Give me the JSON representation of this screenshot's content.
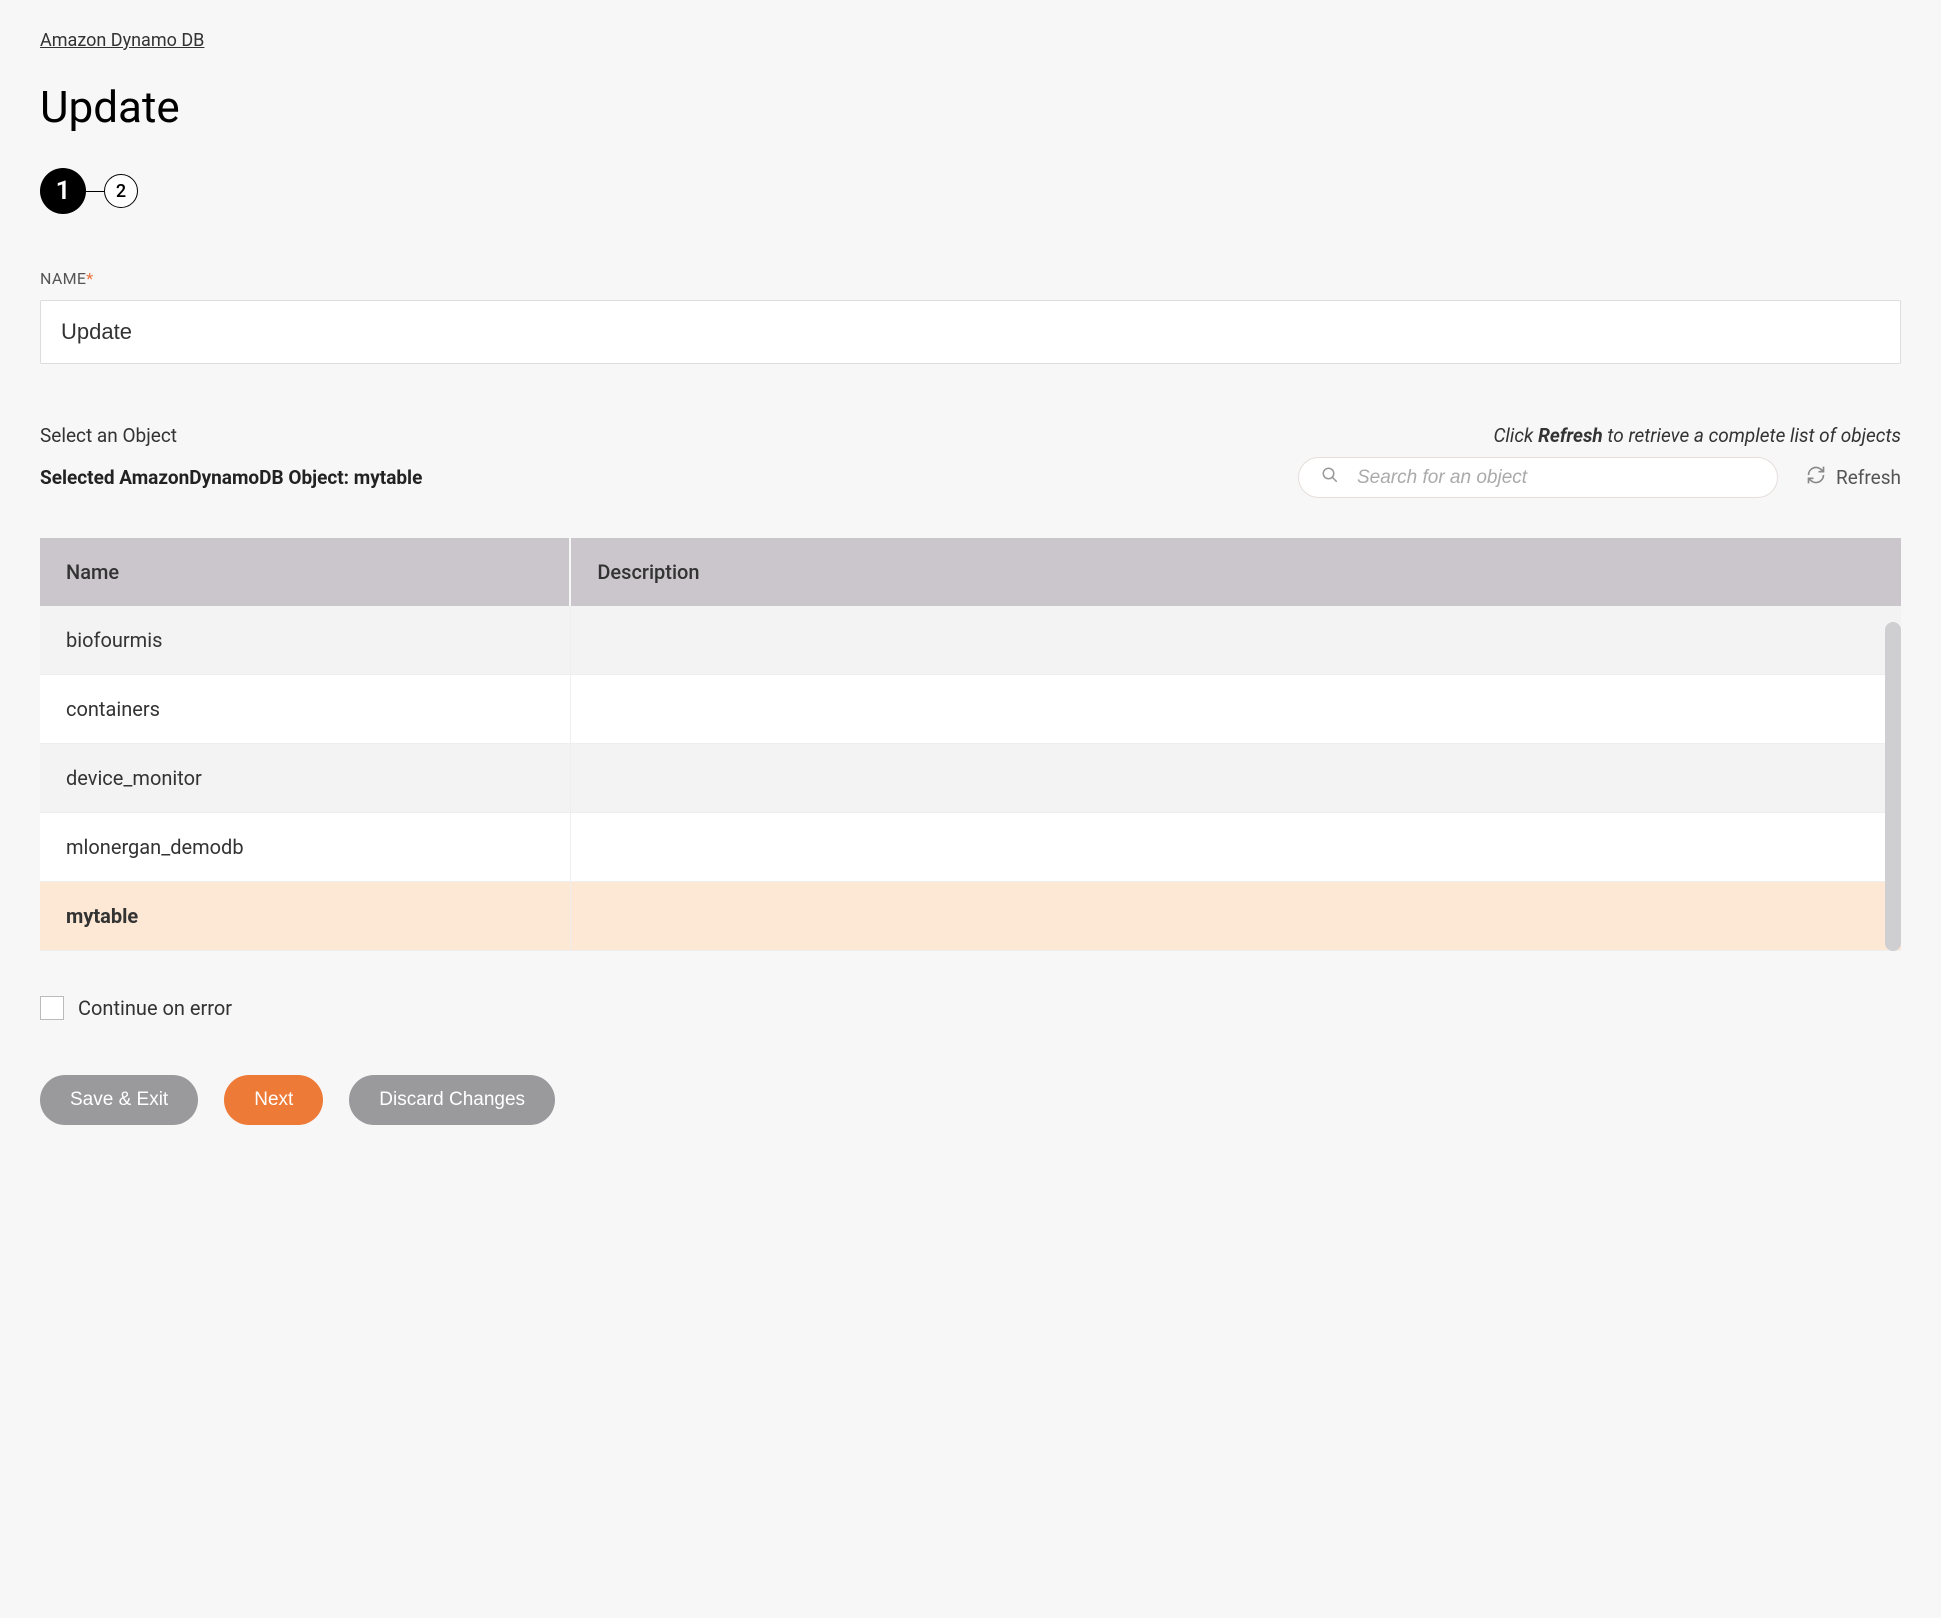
{
  "breadcrumb": "Amazon Dynamo DB",
  "page_title": "Update",
  "stepper": {
    "current": "1",
    "next": "2"
  },
  "name_field": {
    "label": "NAME",
    "value": "Update"
  },
  "section": {
    "select_label": "Select an Object",
    "hint_prefix": "Click ",
    "hint_bold": "Refresh",
    "hint_suffix": " to retrieve a complete list of objects",
    "selected_prefix": "Selected AmazonDynamoDB Object: ",
    "selected_object": "mytable"
  },
  "search": {
    "placeholder": "Search for an object"
  },
  "refresh_label": "Refresh",
  "table": {
    "headers": {
      "name": "Name",
      "description": "Description"
    },
    "rows": [
      {
        "name": "biofourmis",
        "description": "",
        "selected": false
      },
      {
        "name": "containers",
        "description": "",
        "selected": false
      },
      {
        "name": "device_monitor",
        "description": "",
        "selected": false
      },
      {
        "name": "mlonergan_demodb",
        "description": "",
        "selected": false
      },
      {
        "name": "mytable",
        "description": "",
        "selected": true
      }
    ]
  },
  "checkbox": {
    "label": "Continue on error",
    "checked": false
  },
  "buttons": {
    "save_exit": "Save & Exit",
    "next": "Next",
    "discard": "Discard Changes"
  }
}
